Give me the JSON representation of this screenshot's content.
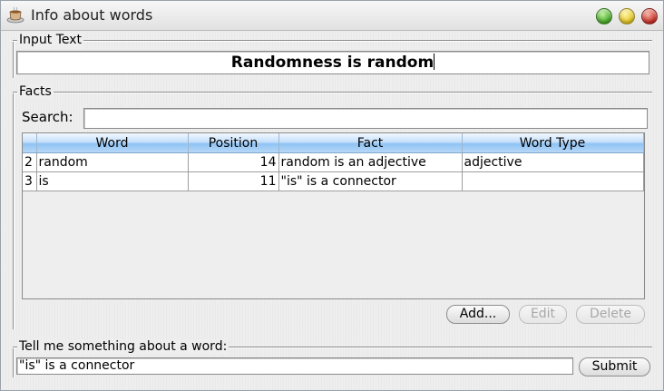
{
  "window": {
    "title": "Info about words",
    "app_icon": "coffee-cup-icon"
  },
  "input_group": {
    "label": "Input Text",
    "value": "Randomness is random"
  },
  "facts_group": {
    "label": "Facts",
    "search_label": "Search:",
    "search_value": "",
    "table": {
      "columns": [
        "Word",
        "Position",
        "Fact",
        "Word Type"
      ],
      "rows": [
        {
          "index": "2",
          "word": "random",
          "position": "14",
          "fact": "random is an adjective",
          "word_type": "adjective"
        },
        {
          "index": "3",
          "word": "is",
          "position": "11",
          "fact": "\"is\" is a connector",
          "word_type": ""
        }
      ]
    },
    "buttons": {
      "add": "Add...",
      "edit": "Edit",
      "delete": "Delete"
    }
  },
  "tell_group": {
    "label": "Tell me something about a word:",
    "value": "\"is\" is a connector",
    "submit": "Submit"
  },
  "colors": {
    "header_blue": "#8fc3f3",
    "close": "#c4271b",
    "minimize": "#e1c118",
    "maximize": "#3fa51e"
  }
}
